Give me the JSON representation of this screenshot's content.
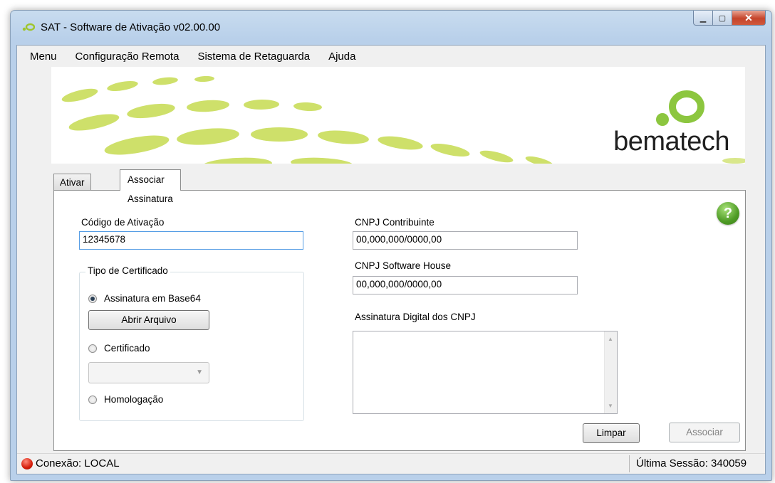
{
  "window": {
    "title": "SAT - Software de Ativação v02.00.00",
    "caption_buttons": {
      "minimize": "minimize-icon",
      "maximize": "maximize-icon",
      "close": "close-icon"
    }
  },
  "menubar": {
    "items": [
      "Menu",
      "Configuração Remota",
      "Sistema de Retaguarda",
      "Ajuda"
    ]
  },
  "banner": {
    "brand": "bematech"
  },
  "tabs": {
    "items": [
      "Ativar SAT",
      "Associar Assinatura"
    ],
    "active": "Associar Assinatura"
  },
  "form": {
    "codigo_label": "Código de Ativação",
    "codigo_value": "12345678",
    "tipo_certificado_title": "Tipo de Certificado",
    "radio_base64": "Assinatura em Base64",
    "abrir_arquivo": "Abrir Arquivo",
    "radio_certificado": "Certificado",
    "radio_homologacao": "Homologação",
    "cnpj_contribuinte_label": "CNPJ Contribuinte",
    "cnpj_contribuinte_value": "00,000,000/0000,00",
    "cnpj_sh_label": "CNPJ Software House",
    "cnpj_sh_value": "00,000,000/0000,00",
    "assinatura_label": "Assinatura Digital dos CNPJ",
    "help": "?",
    "limpar": "Limpar",
    "associar": "Associar"
  },
  "statusbar": {
    "connection": "Conexão: LOCAL",
    "session": "Última Sessão: 340059"
  },
  "colors": {
    "accent_green": "#b7d43c",
    "status_red": "#d51d0a",
    "help_green": "#4e9b25"
  }
}
